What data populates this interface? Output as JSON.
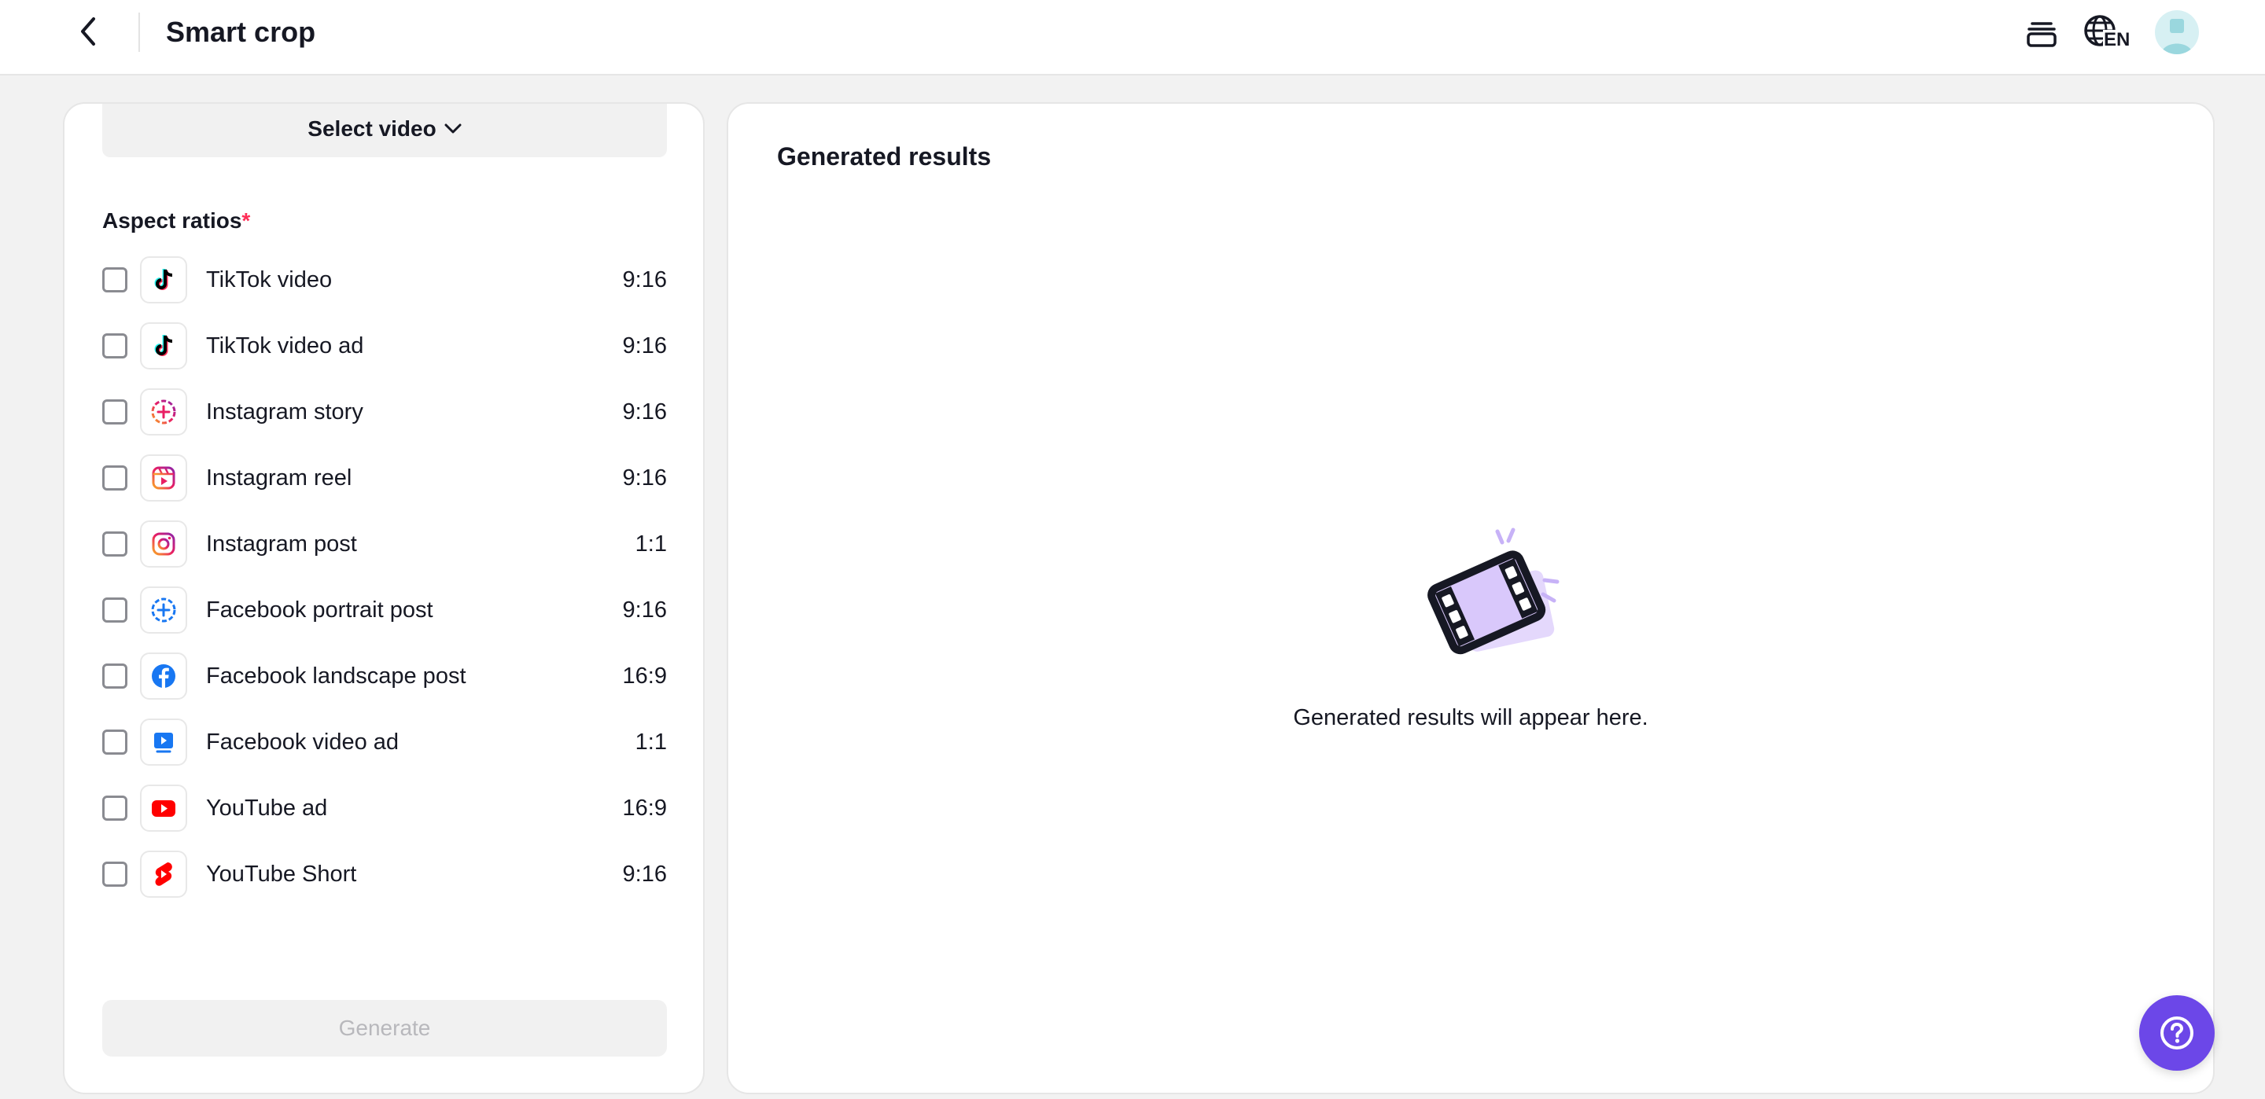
{
  "header": {
    "title": "Smart crop",
    "language_badge": "EN"
  },
  "left_panel": {
    "select_video_label": "Select video",
    "aspect_title": "Aspect ratios",
    "required_mark": "*",
    "ratios": [
      {
        "label": "TikTok video",
        "ratio": "9:16",
        "icon": "tiktok-icon"
      },
      {
        "label": "TikTok video ad",
        "ratio": "9:16",
        "icon": "tiktok-icon"
      },
      {
        "label": "Instagram story",
        "ratio": "9:16",
        "icon": "instagram-story-icon"
      },
      {
        "label": "Instagram reel",
        "ratio": "9:16",
        "icon": "instagram-reel-icon"
      },
      {
        "label": "Instagram post",
        "ratio": "1:1",
        "icon": "instagram-post-icon"
      },
      {
        "label": "Facebook portrait post",
        "ratio": "9:16",
        "icon": "facebook-story-icon"
      },
      {
        "label": "Facebook landscape post",
        "ratio": "16:9",
        "icon": "facebook-icon"
      },
      {
        "label": "Facebook video ad",
        "ratio": "1:1",
        "icon": "facebook-video-icon"
      },
      {
        "label": "YouTube ad",
        "ratio": "16:9",
        "icon": "youtube-icon"
      },
      {
        "label": "YouTube Short",
        "ratio": "9:16",
        "icon": "youtube-shorts-icon"
      }
    ],
    "generate_label": "Generate"
  },
  "right_panel": {
    "title": "Generated results",
    "empty_message": "Generated results will appear here."
  },
  "colors": {
    "accent": "#6c47e8",
    "required": "#fe2c55",
    "illustration": "#d9c8fb"
  }
}
